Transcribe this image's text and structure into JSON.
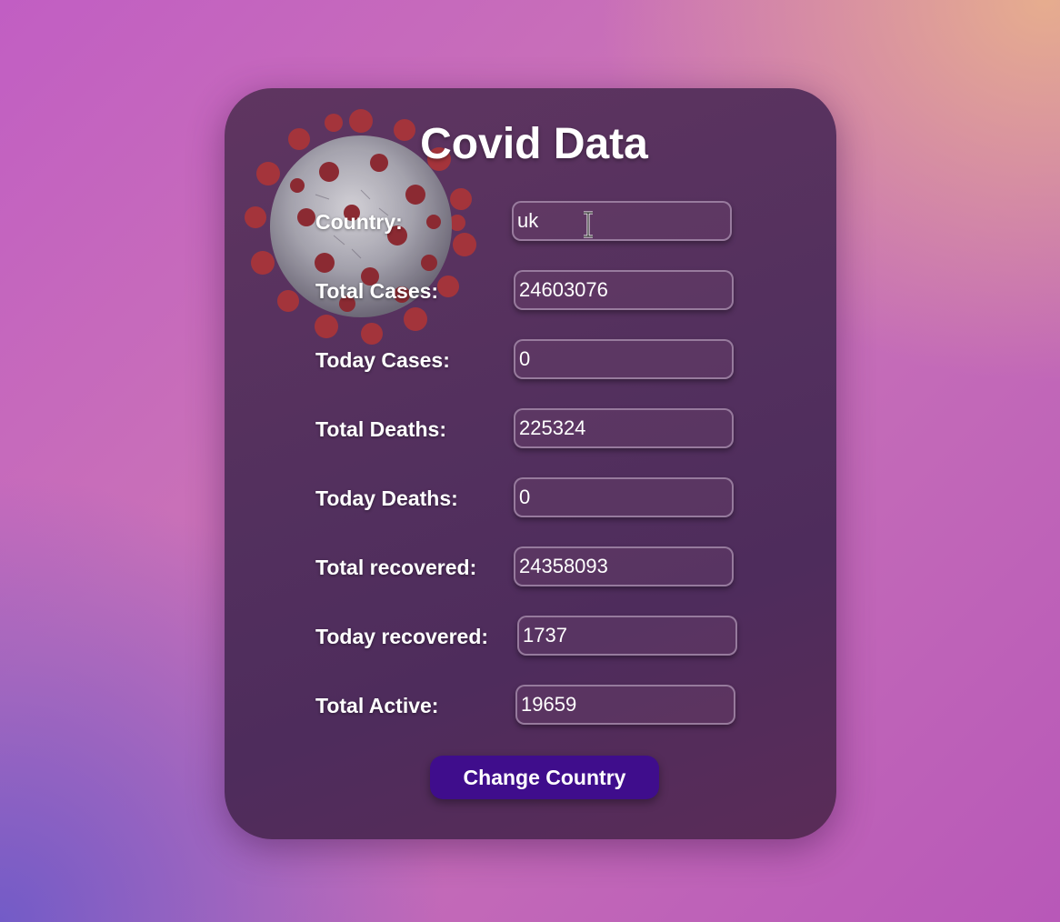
{
  "title": "Covid Data",
  "fields": {
    "country": {
      "label": "Country:",
      "value": "uk"
    },
    "total_cases": {
      "label": "Total Cases:",
      "value": "24603076"
    },
    "today_cases": {
      "label": "Today Cases:",
      "value": "0"
    },
    "total_deaths": {
      "label": "Total Deaths:",
      "value": "225324"
    },
    "today_deaths": {
      "label": "Today Deaths:",
      "value": "0"
    },
    "total_recovered": {
      "label": "Total recovered:",
      "value": "24358093"
    },
    "today_recovered": {
      "label": "Today recovered:",
      "value": "1737"
    },
    "total_active": {
      "label": "Total Active:",
      "value": "19659"
    }
  },
  "button": {
    "label": "Change Country"
  },
  "colors": {
    "card": "#53305e",
    "button": "#3f0d8c",
    "text": "#ffffff"
  },
  "icons": {
    "virus": "coronavirus-image",
    "cursor": "text-cursor-icon"
  }
}
